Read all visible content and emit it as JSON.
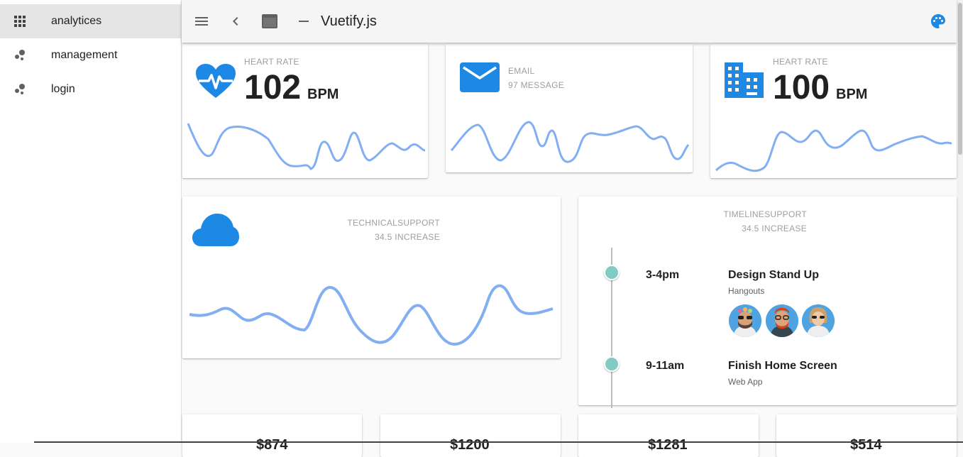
{
  "sidebar": {
    "items": [
      {
        "label": "analytices",
        "icon": "apps-grid-icon",
        "active": true
      },
      {
        "label": "management",
        "icon": "bubbles-icon",
        "active": false
      },
      {
        "label": "login",
        "icon": "bubbles-icon",
        "active": false
      }
    ]
  },
  "toolbar": {
    "title": "Vuetify.js",
    "icons": [
      "menu-icon",
      "chevron-left-icon",
      "window-icon",
      "minimize-icon",
      "palette-icon"
    ]
  },
  "cards": {
    "heart1": {
      "caption": "HEART RATE",
      "value": "102",
      "unit": "BPM",
      "icon": "heart-pulse-icon"
    },
    "email": {
      "caption": "EMAIL",
      "sub": "97 MESSAGE",
      "icon": "email-icon"
    },
    "heart2": {
      "caption": "HEART RATE",
      "value": "100",
      "unit": "BPM",
      "icon": "building-icon"
    },
    "technical": {
      "caption": "TECHNICALSUPPORT",
      "sub": "34.5 INCREASE",
      "icon": "cloud-icon"
    },
    "timeline": {
      "caption": "TIMELINESUPPORT",
      "sub": "34.5 INCREASE",
      "events": [
        {
          "time": "3-4pm",
          "title": "Design Stand Up",
          "subtitle": "Hangouts"
        },
        {
          "time": "9-11am",
          "title": "Finish Home Screen",
          "subtitle": "Web App"
        }
      ]
    }
  },
  "stats": [
    "$874",
    "$1200",
    "$1281",
    "$514"
  ],
  "colors": {
    "accent": "#1e88e5",
    "spark": "#82aef2",
    "dot": "#80cbc4"
  }
}
